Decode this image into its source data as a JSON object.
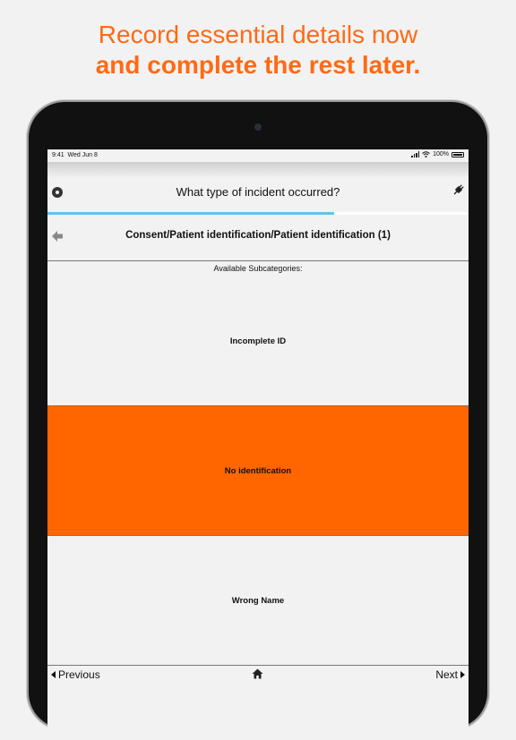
{
  "headline": {
    "line1": "Record essential details now",
    "line2": "and complete the rest later."
  },
  "status_bar": {
    "time": "9:41",
    "date": "Wed Jun 8",
    "battery": "100%"
  },
  "header": {
    "question": "What type of incident occurred?",
    "left_icon": "gear-icon",
    "right_icon": "plug-icon"
  },
  "progress": {
    "fraction": 0.68,
    "color": "#62c3ea"
  },
  "path": {
    "back_icon": "back-arrow-icon",
    "title": "Consent/Patient identification/Patient identification (1)"
  },
  "subcategories": {
    "heading": "Available Subcategories:",
    "items": [
      {
        "label": "Incomplete ID",
        "selected": false
      },
      {
        "label": "No identification",
        "selected": true
      },
      {
        "label": "Wrong Name",
        "selected": false
      }
    ]
  },
  "footer": {
    "previous": "Previous",
    "next": "Next",
    "home_icon": "home-icon"
  },
  "colors": {
    "accent": "#ff6a14",
    "selected": "#ff6600",
    "background": "#f2f2f2"
  }
}
